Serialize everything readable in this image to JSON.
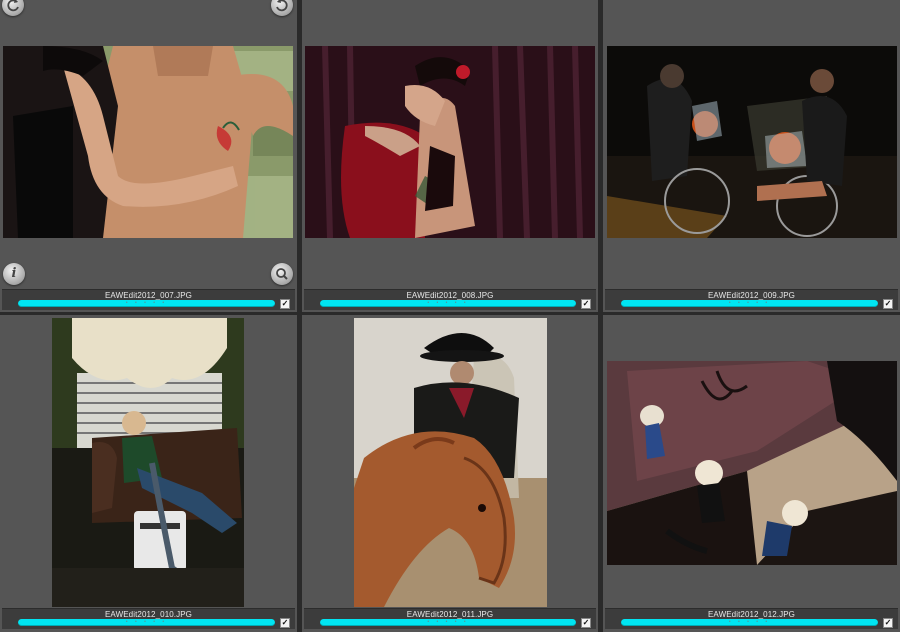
{
  "thumbnails": [
    {
      "filename": "EAWEdit2012_007.JPG",
      "checked": true,
      "rating_dots": "• • • • •"
    },
    {
      "filename": "EAWEdit2012_008.JPG",
      "checked": true,
      "rating_dots": "• • • • •"
    },
    {
      "filename": "EAWEdit2012_009.JPG",
      "checked": true,
      "rating_dots": "• • • • •"
    },
    {
      "filename": "EAWEdit2012_010.JPG",
      "checked": true,
      "rating_dots": "• • • • •"
    },
    {
      "filename": "EAWEdit2012_011.JPG",
      "checked": true,
      "rating_dots": "• • • • •"
    },
    {
      "filename": "EAWEdit2012_012.JPG",
      "checked": true,
      "rating_dots": "• • • • •"
    }
  ],
  "check_glyph": "✓",
  "info_glyph": "i",
  "icons": {
    "info": "info-icon",
    "zoom": "magnifier-icon",
    "rotate_left": "rotate-left-icon",
    "rotate_right": "rotate-right-icon"
  },
  "colors": {
    "rating_bar": "#00e5f2",
    "cell_bg": "#555555",
    "grid_bg": "#2a2a2a"
  }
}
